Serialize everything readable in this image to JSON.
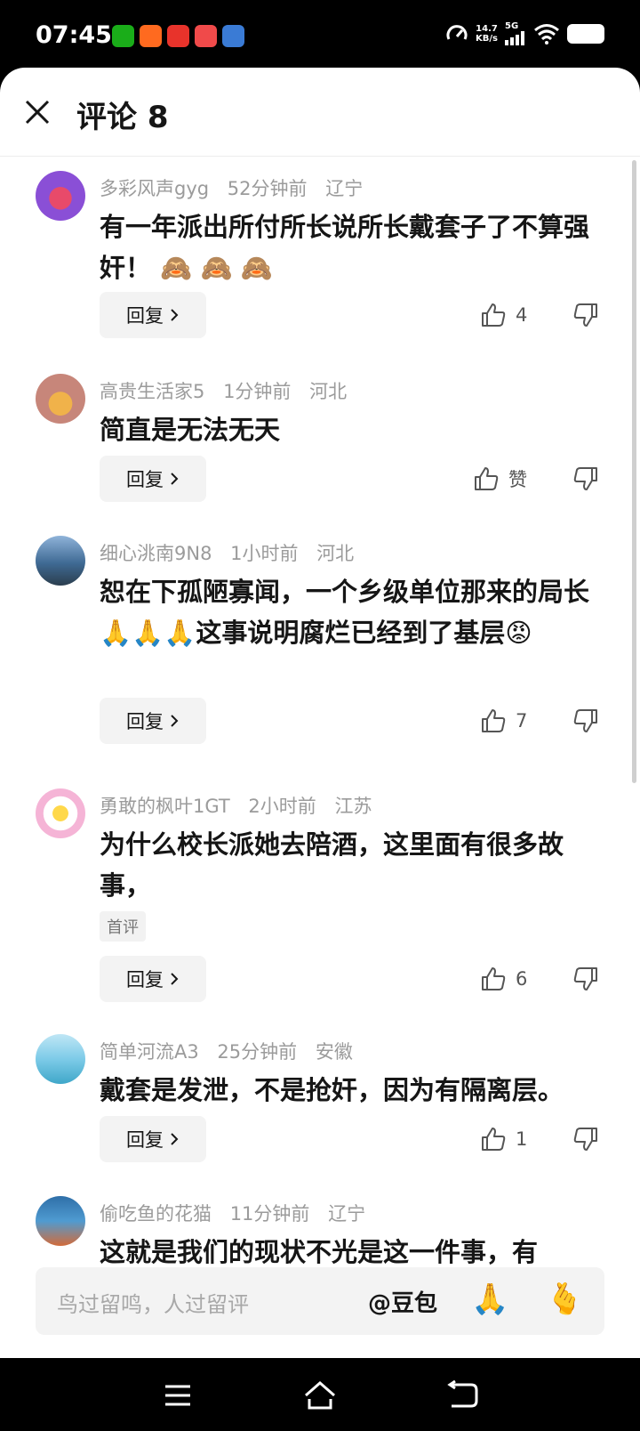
{
  "status_bar": {
    "time": "07:45",
    "app_icons": [
      "wechat-icon",
      "app-icon",
      "toutiao-icon",
      "app-icon",
      "app-icon"
    ],
    "net_speed_value": "14.7",
    "net_speed_unit": "KB/s",
    "network": "5G"
  },
  "header": {
    "title": "评论 8"
  },
  "comments": [
    {
      "user": "多彩风声gyg",
      "time": "52分钟前",
      "location": "辽宁",
      "text": "有一年派出所付所长说所长戴套子了不算强奸！",
      "emojis": "🙈 🙈 🙈",
      "likes": "4",
      "reply": "回复"
    },
    {
      "user": "高贵生活家5",
      "time": "1分钟前",
      "location": "河北",
      "text": "简直是无法无天",
      "likes": "赞",
      "reply": "回复"
    },
    {
      "user": "细心洮南9N8",
      "time": "1小时前",
      "location": "河北",
      "text_a": "恕在下孤陋寡闻，一个乡级单位那来的局长",
      "emojis_a": "🙏🙏🙏",
      "text_b": "这事说明腐烂已经到了基层",
      "emojis_b": "😡",
      "likes": "7",
      "reply": "回复"
    },
    {
      "user": "勇敢的枫叶1GT",
      "time": "2小时前",
      "location": "江苏",
      "text": "为什么校长派她去陪酒，这里面有很多故事，",
      "badge": "首评",
      "likes": "6",
      "reply": "回复"
    },
    {
      "user": "简单河流A3",
      "time": "25分钟前",
      "location": "安徽",
      "text": "戴套是发泄，不是抢奸，因为有隔离层。",
      "likes": "1",
      "reply": "回复"
    },
    {
      "user": "偷吃鱼的花猫",
      "time": "11分钟前",
      "location": "辽宁",
      "text": "这就是我们的现状不光是这一件事，有"
    }
  ],
  "input_bar": {
    "placeholder": "鸟过留鸣，人过留评",
    "mention": "@豆包",
    "emoji_1": "🙏",
    "emoji_2": "🫰"
  },
  "colors": {
    "accent_text": "#161616",
    "meta_text": "#9b9b9b",
    "button_bg": "#f3f3f3"
  }
}
